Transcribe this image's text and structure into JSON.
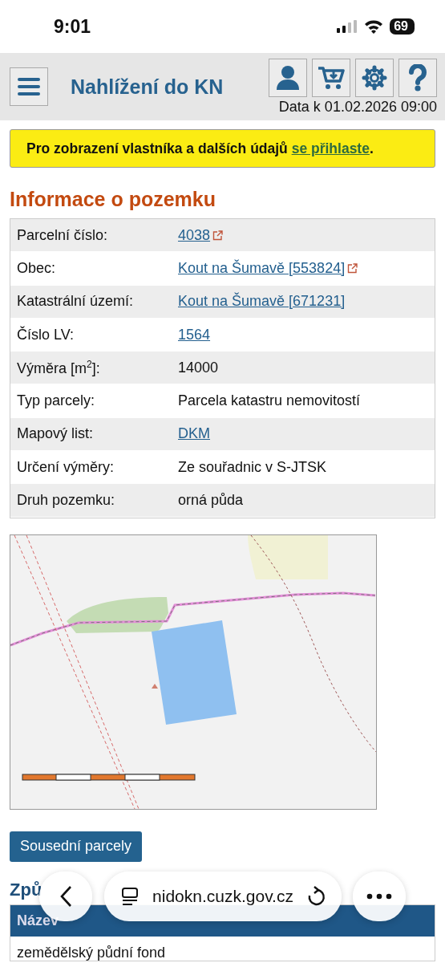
{
  "status_bar": {
    "time": "9:01",
    "battery": "69"
  },
  "header": {
    "title": "Nahlížení do KN",
    "data_date": "Data k 01.02.2026 09:00"
  },
  "notice": {
    "text": "Pro zobrazení vlastníka a dalších údajů ",
    "link": "se přihlaste",
    "end": "."
  },
  "section_title": "Informace o pozemku",
  "info_rows": [
    {
      "label": "Parcelní číslo:",
      "value": "4038",
      "kind": "link",
      "external": true
    },
    {
      "label": "Obec:",
      "value": "Kout na Šumavě [553824]",
      "kind": "link",
      "external": true
    },
    {
      "label": "Katastrální území:",
      "value": "Kout na Šumavě [671231]",
      "kind": "link",
      "external": false
    },
    {
      "label": "Číslo LV:",
      "value": "1564",
      "kind": "link",
      "external": false
    },
    {
      "label": "Výměra [m$^{2}$]:",
      "value": "14000",
      "kind": "text",
      "external": false
    },
    {
      "label": "Typ parcely:",
      "value": "Parcela katastru nemovitostí",
      "kind": "text",
      "external": false
    },
    {
      "label": "Mapový list:",
      "value": "DKM",
      "kind": "link",
      "external": false
    },
    {
      "label": "Určení výměry:",
      "value": "Ze souřadnic v S-JTSK",
      "kind": "text",
      "external": false
    },
    {
      "label": "Druh pozemku:",
      "value": "orná půda",
      "kind": "text",
      "external": false
    }
  ],
  "neighbors_button": "Sousední parcely",
  "use_section": {
    "title": "Způ",
    "columns": [
      "Název"
    ],
    "rows": [
      "zemědělský půdní fond"
    ]
  },
  "browser_bar": {
    "url": "nidokn.cuzk.gov.cz"
  }
}
